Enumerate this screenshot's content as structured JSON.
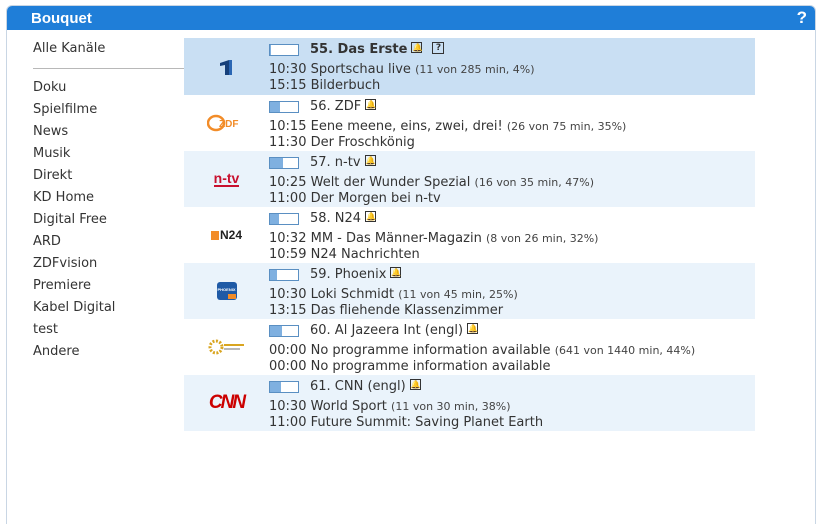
{
  "title": "Bouquet",
  "help": "?",
  "sidebar": {
    "first": "Alle Kanäle",
    "items": [
      "Doku",
      "Spielfilme",
      "News",
      "Musik",
      "Direkt",
      "KD Home",
      "Digital Free",
      "ARD",
      "ZDFvision",
      "Premiere",
      "Kabel Digital",
      "test",
      "Andere"
    ]
  },
  "channels": [
    {
      "name": "55. Das Erste",
      "logo": "das-erste-logo",
      "progress": 0.04,
      "now": {
        "time": "10:30",
        "title": "Sportschau live",
        "info": "(11 von 285 min, 4%)"
      },
      "next": {
        "time": "15:15",
        "title": "Bilderbuch"
      }
    },
    {
      "name": "56. ZDF",
      "logo": "zdf-logo",
      "progress": 0.35,
      "now": {
        "time": "10:15",
        "title": "Eene meene, eins, zwei, drei!",
        "info": "(26 von 75 min, 35%)"
      },
      "next": {
        "time": "11:30",
        "title": "Der Froschkönig"
      }
    },
    {
      "name": "57. n-tv",
      "logo": "n-tv-logo",
      "progress": 0.47,
      "now": {
        "time": "10:25",
        "title": "Welt der Wunder Spezial",
        "info": "(16 von 35 min, 47%)"
      },
      "next": {
        "time": "11:00",
        "title": "Der Morgen bei n-tv"
      }
    },
    {
      "name": "58. N24",
      "logo": "n24-logo",
      "progress": 0.32,
      "now": {
        "time": "10:32",
        "title": "MM - Das Männer-Magazin",
        "info": "(8 von 26 min, 32%)"
      },
      "next": {
        "time": "10:59",
        "title": "N24 Nachrichten"
      }
    },
    {
      "name": "59. Phoenix",
      "logo": "phoenix-logo",
      "progress": 0.25,
      "now": {
        "time": "10:30",
        "title": "Loki Schmidt",
        "info": "(11 von 45 min, 25%)"
      },
      "next": {
        "time": "13:15",
        "title": "Das fliehende Klassenzimmer"
      }
    },
    {
      "name": "60. Al Jazeera Int (engl)",
      "logo": "al-jazeera-logo",
      "progress": 0.44,
      "now": {
        "time": "00:00",
        "title": "No programme information available",
        "info": "(641 von 1440 min, 44%)"
      },
      "next": {
        "time": "00:00",
        "title": "No programme information available"
      }
    },
    {
      "name": "61. CNN (engl)",
      "logo": "cnn-logo",
      "progress": 0.38,
      "now": {
        "time": "10:30",
        "title": "World Sport",
        "info": "(11 von 30 min, 38%)"
      },
      "next": {
        "time": "11:00",
        "title": "Future Summit: Saving Planet Earth"
      }
    }
  ],
  "logos": {
    "zdf": "ZDF",
    "ntv": "n-tv",
    "n24": "N24",
    "phoenix": "PHOENIX",
    "cnn": "CNN"
  }
}
